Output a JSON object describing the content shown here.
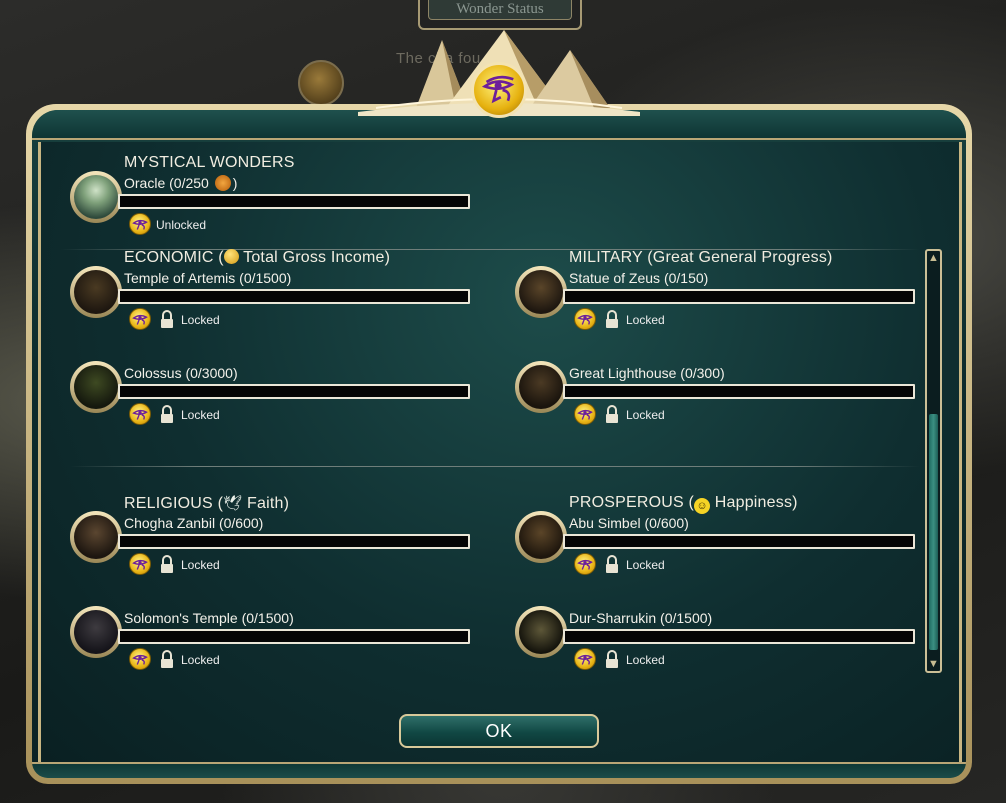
{
  "background": {
    "tab_label": "Wonder Status",
    "hint_text": "The  cha   fou  ed."
  },
  "header_icon": "eye-of-horus-icon",
  "sections": {
    "mystical": {
      "title": "MYSTICAL WONDERS",
      "wonders": [
        {
          "name": "Oracle (0/250",
          "name_suffix": ")",
          "icon": "oracle",
          "status": "Unlocked",
          "progress": 0
        }
      ]
    },
    "economic": {
      "title_prefix": "ECONOMIC (",
      "title_suffix": " Total Gross Income)",
      "title_icon": "gold-coin-icon",
      "wonders": [
        {
          "name": "Temple of Artemis (0/1500)",
          "status": "Locked",
          "progress": 0
        },
        {
          "name": "Colossus (0/3000)",
          "status": "Locked",
          "progress": 0
        }
      ]
    },
    "military": {
      "title": "MILITARY (Great General Progress)",
      "wonders": [
        {
          "name": "Statue of Zeus (0/150)",
          "status": "Locked",
          "progress": 0
        },
        {
          "name": "Great Lighthouse (0/300)",
          "status": "Locked",
          "progress": 0
        }
      ]
    },
    "religious": {
      "title_prefix": "RELIGIOUS (",
      "title_suffix": " Faith)",
      "title_icon": "dove-faith-icon",
      "wonders": [
        {
          "name": "Chogha Zanbil (0/600)",
          "status": "Locked",
          "progress": 0
        },
        {
          "name": "Solomon's Temple (0/1500)",
          "status": "Locked",
          "progress": 0
        }
      ]
    },
    "prosperous": {
      "title_prefix": "PROSPEROUS (",
      "title_suffix": " Happiness)",
      "title_icon": "smiley-happiness-icon",
      "wonders": [
        {
          "name": "Abu Simbel (0/600)",
          "status": "Locked",
          "progress": 0
        },
        {
          "name": "Dur-Sharrukin (0/1500)",
          "status": "Locked",
          "progress": 0
        }
      ]
    }
  },
  "colors": {
    "panel": "#0d2b2c",
    "gold_trim": "#c8b682",
    "eye_gold": "#e8b415",
    "progress_fill": "#d8b43a"
  },
  "ok_label": "OK"
}
